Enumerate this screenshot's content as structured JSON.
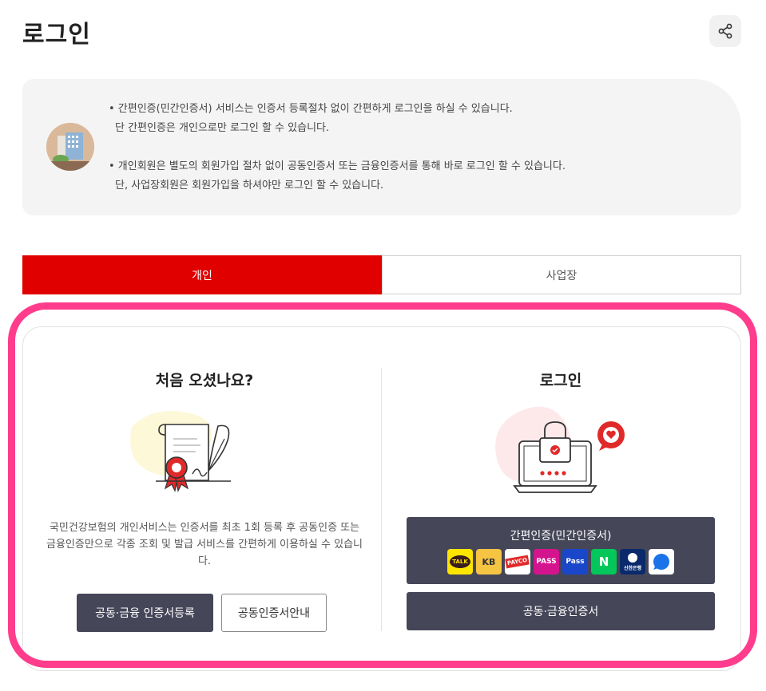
{
  "header": {
    "title": "로그인",
    "share_icon": "share-icon"
  },
  "notice": {
    "avatar_icon": "building-icon",
    "lines": [
      "• 간편인증(민간인증서) 서비스는 인증서 등록절차 없이 간편하게 로그인을 하실 수 있습니다.",
      "단 간편인증은 개인으로만 로그인 할 수 있습니다.",
      "• 개인회원은 별도의 회원가입 절차 없이 공동인증서 또는 금융인증서를 통해 바로 로그인 할 수 있습니다.",
      "단, 사업장회원은 회원가입을 하셔야만 로그인 할 수 있습니다."
    ]
  },
  "tabs": [
    {
      "label": "개인",
      "active": true
    },
    {
      "label": "사업장",
      "active": false
    }
  ],
  "left": {
    "title": "처음 오셨나요?",
    "illustration": "certificate-icon",
    "description": "국민건강보험의 개인서비스는 인증서를 최초 1회 등록 후 공동인증 또는 금융인증만으로 각종 조회 및 발급 서비스를 간편하게 이용하실 수 있습니다.",
    "register_button": "공동·금융 인증서등록",
    "guide_button": "공동인증서안내"
  },
  "right": {
    "title": "로그인",
    "illustration": "laptop-lock-icon",
    "easy_auth_label": "간편인증(민간인증서)",
    "providers": [
      {
        "name": "TALK",
        "icon": "kakao-talk-icon",
        "bg": "#fee500",
        "fg": "#3a1d1d"
      },
      {
        "name": "KB",
        "icon": "kb-icon",
        "bg": "#f6c443",
        "fg": "#333333"
      },
      {
        "name": "PAYCO",
        "icon": "payco-icon",
        "bg": "#ffffff",
        "fg": "#ffffff"
      },
      {
        "name": "PASS",
        "icon": "pass-icon",
        "bg": "#d4148f",
        "fg": "#ffffff"
      },
      {
        "name": "Pass",
        "icon": "samsung-pass-icon",
        "bg": "#1a47c9",
        "fg": "#ffffff"
      },
      {
        "name": "N",
        "icon": "naver-icon",
        "bg": "#03c75a",
        "fg": "#ffffff"
      },
      {
        "name": "신한은행",
        "icon": "shinhan-icon",
        "bg": "#0a2a6b",
        "fg": "#ffffff"
      },
      {
        "name": "",
        "icon": "toss-icon",
        "bg": "#ffffff",
        "fg": "#1a73e8"
      }
    ],
    "cert_button": "공동·금융인증서"
  },
  "colors": {
    "accent": "#e00000",
    "dark_button": "#464659",
    "highlight": "#ff3d8c"
  }
}
